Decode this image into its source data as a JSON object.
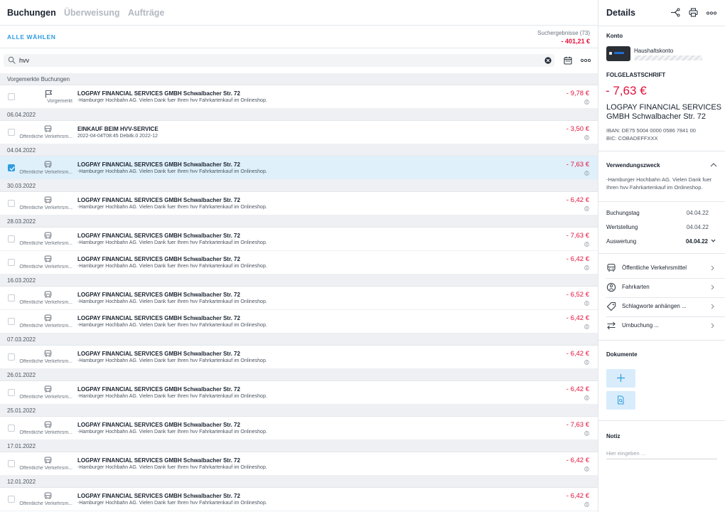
{
  "tabs": {
    "buchungen": "Buchungen",
    "ueberweisung": "Überweisung",
    "auftraege": "Aufträge"
  },
  "toolbar": {
    "select_all": "ALLE WÄHLEN",
    "results_label": "Suchergebnisse (73)",
    "results_sum": "- 401,21 €"
  },
  "search": {
    "value": "hvv",
    "icons": [
      "search-icon",
      "clear-icon",
      "calendar-icon",
      "more-icon"
    ]
  },
  "groups": [
    {
      "header": "Vorgemerkte Buchungen",
      "rows": [
        {
          "icon": "flag-icon",
          "category": "Vorgemerkt",
          "title": "LOGPAY FINANCIAL SERVICES GMBH Schwalbacher Str. 72",
          "desc": "-Hamburger Hochbahn AG. Vielen Dank fuer Ihren hvv Fahrkartenkauf im Onlineshop.",
          "amount": "- 9,78 €",
          "selected": false
        }
      ]
    },
    {
      "header": "06.04.2022",
      "rows": [
        {
          "icon": "car-icon",
          "category": "Öffentliche Verkehrsm...",
          "title": "EINKAUF BEIM HVV-SERVICE",
          "desc": "2022-04-04T08:45 Debitk.0 2022-12",
          "amount": "- 3,50 €",
          "selected": false
        }
      ]
    },
    {
      "header": "04.04.2022",
      "rows": [
        {
          "icon": "car-icon",
          "category": "Öffentliche Verkehrsm...",
          "title": "LOGPAY FINANCIAL SERVICES GMBH Schwalbacher Str. 72",
          "desc": "-Hamburger Hochbahn AG. Vielen Dank fuer Ihren hvv Fahrkartenkauf im Onlineshop.",
          "amount": "- 7,63 €",
          "selected": true
        }
      ]
    },
    {
      "header": "30.03.2022",
      "rows": [
        {
          "icon": "car-icon",
          "category": "Öffentliche Verkehrsm...",
          "title": "LOGPAY FINANCIAL SERVICES GMBH Schwalbacher Str. 72",
          "desc": "-Hamburger Hochbahn AG. Vielen Dank fuer Ihren hvv Fahrkartenkauf im Onlineshop.",
          "amount": "- 6,42 €",
          "selected": false
        }
      ]
    },
    {
      "header": "28.03.2022",
      "rows": [
        {
          "icon": "car-icon",
          "category": "Öffentliche Verkehrsm...",
          "title": "LOGPAY FINANCIAL SERVICES GMBH Schwalbacher Str. 72",
          "desc": "-Hamburger Hochbahn AG. Vielen Dank fuer Ihren hvv Fahrkartenkauf im Onlineshop.",
          "amount": "- 7,63 €",
          "selected": false
        },
        {
          "icon": "car-icon",
          "category": "Öffentliche Verkehrsm...",
          "title": "LOGPAY FINANCIAL SERVICES GMBH Schwalbacher Str. 72",
          "desc": "-Hamburger Hochbahn AG. Vielen Dank fuer Ihren hvv Fahrkartenkauf im Onlineshop.",
          "amount": "- 6,42 €",
          "selected": false
        }
      ]
    },
    {
      "header": "16.03.2022",
      "rows": [
        {
          "icon": "car-icon",
          "category": "Öffentliche Verkehrsm...",
          "title": "LOGPAY FINANCIAL SERVICES GMBH Schwalbacher Str. 72",
          "desc": "-Hamburger Hochbahn AG. Vielen Dank fuer Ihren hvv Fahrkartenkauf im Onlineshop.",
          "amount": "- 6,52 €",
          "selected": false
        },
        {
          "icon": "car-icon",
          "category": "Öffentliche Verkehrsm...",
          "title": "LOGPAY FINANCIAL SERVICES GMBH Schwalbacher Str. 72",
          "desc": "-Hamburger Hochbahn AG. Vielen Dank fuer Ihren hvv Fahrkartenkauf im Onlineshop.",
          "amount": "- 6,42 €",
          "selected": false
        }
      ]
    },
    {
      "header": "07.03.2022",
      "rows": [
        {
          "icon": "car-icon",
          "category": "Öffentliche Verkehrsm...",
          "title": "LOGPAY FINANCIAL SERVICES GMBH Schwalbacher Str. 72",
          "desc": "-Hamburger Hochbahn AG. Vielen Dank fuer Ihren hvv Fahrkartenkauf im Onlineshop.",
          "amount": "- 6,42 €",
          "selected": false
        }
      ]
    },
    {
      "header": "26.01.2022",
      "rows": [
        {
          "icon": "car-icon",
          "category": "Öffentliche Verkehrsm...",
          "title": "LOGPAY FINANCIAL SERVICES GMBH Schwalbacher Str. 72",
          "desc": "-Hamburger Hochbahn AG. Vielen Dank fuer Ihren hvv Fahrkartenkauf im Onlineshop.",
          "amount": "- 6,42 €",
          "selected": false
        }
      ]
    },
    {
      "header": "25.01.2022",
      "rows": [
        {
          "icon": "car-icon",
          "category": "Öffentliche Verkehrsm...",
          "title": "LOGPAY FINANCIAL SERVICES GMBH Schwalbacher Str. 72",
          "desc": "-Hamburger Hochbahn AG. Vielen Dank fuer Ihren hvv Fahrkartenkauf im Onlineshop.",
          "amount": "- 7,63 €",
          "selected": false
        }
      ]
    },
    {
      "header": "17.01.2022",
      "rows": [
        {
          "icon": "car-icon",
          "category": "Öffentliche Verkehrsm...",
          "title": "LOGPAY FINANCIAL SERVICES GMBH Schwalbacher Str. 72",
          "desc": "-Hamburger Hochbahn AG. Vielen Dank fuer Ihren hvv Fahrkartenkauf im Onlineshop.",
          "amount": "- 6,42 €",
          "selected": false
        }
      ]
    },
    {
      "header": "12.01.2022",
      "rows": [
        {
          "icon": "car-icon",
          "category": "Öffentliche Verkehrsm...",
          "title": "LOGPAY FINANCIAL SERVICES GMBH Schwalbacher Str. 72",
          "desc": "-Hamburger Hochbahn AG. Vielen Dank fuer Ihren hvv Fahrkartenkauf im Onlineshop.",
          "amount": "- 6,42 €",
          "selected": false
        }
      ]
    }
  ],
  "details": {
    "title": "Details",
    "konto_label": "Konto",
    "konto_name": "Haushaltskonto",
    "type_label": "FOLGELASTSCHRIFT",
    "amount": "- 7,63 €",
    "payee": "LOGPAY FINANCIAL SERVICES GMBH Schwalbacher Str. 72",
    "iban": "IBAN: DE75 5004 0000 0586 7841 00",
    "bic": "BIC: COBADEFFXXX",
    "vz_label": "Verwendungszweck",
    "vz_text": "-Hamburger Hochbahn AG. Vielen Dank fuer Ihren hvv Fahrkartenkauf im Onlineshop.",
    "buchungstag_label": "Buchungstag",
    "buchungstag": "04.04.22",
    "wertstellung_label": "Wertstellung",
    "wertstellung": "04.04.22",
    "auswertung_label": "Auswertung",
    "auswertung": "04.04.22",
    "actions": [
      {
        "icon": "car-icon",
        "label": "Öffentliche Verkehrsmittel"
      },
      {
        "icon": "ticket-icon",
        "label": "Fahrkarten"
      },
      {
        "icon": "tag-icon",
        "label": "Schlagworte anhängen ..."
      },
      {
        "icon": "transfer-icon",
        "label": "Umbuchung ..."
      }
    ],
    "dokumente_label": "Dokumente",
    "notiz_label": "Notiz",
    "notiz_placeholder": "Hier eingeben ..."
  },
  "colors": {
    "accent": "#2d9de0",
    "negative": "#e3123b",
    "selected_row": "#dff0fb",
    "group_header": "#eef0f3",
    "doc_button": "#d8ecfb"
  }
}
